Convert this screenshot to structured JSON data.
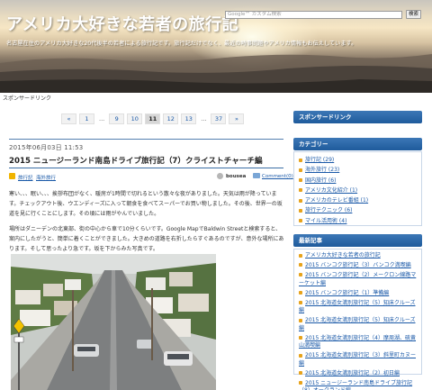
{
  "header": {
    "title": "アメリカ大好きな若者の旅行記",
    "description": "名古屋在住のアメリカ大好きな20代後半の若者による旅行記です。旅行記だけでなく、最近の時事問題やアメリカ情報もお伝えしています。",
    "search_placeholder": "Google™ カスタム検索",
    "search_button": "検索"
  },
  "sponsor_top": "スポンサードリンク",
  "pagination": [
    "«",
    "1",
    "...",
    "9",
    "10",
    "11",
    "12",
    "13",
    "...",
    "37",
    "»"
  ],
  "current_page": "11",
  "post": {
    "date": "2015年06月03日 11:53",
    "title": "2015 ニュージーランド南島ドライブ旅行記（7）クライストチャーチ編",
    "categories": [
      "旅行記",
      "海外旅行"
    ],
    "author": "bousea",
    "comments": "Comment(0)",
    "paragraph1": "寒い、、、眠い、、、挨拶布団がなく、暖房が1時間で切れるという散々な夜がありました。天気は雨が降っています。チェックアウト後、ウエンディーズに入って朝食を食べてスーパーでお買い物しました。その後、世界一の坂道を見に行くことにします。その頃には雨がやんでいました。",
    "paragraph2": "場所はダニーデンの北東部、街の中心から車で10分くらいです。Google MapでBaldwin Streetと検索すると、案内にしたがうと、簡単に着くことができました。大きめの道路を右折したらすぐあるのですが、意外な場所にあります。そして思ったより急です。坂を下からみた写真です。"
  },
  "sidebar": {
    "sponsor_title": "スポンサードリンク",
    "category_title": "カテゴリー",
    "categories": [
      "旅行記 (29)",
      "海外旅行 (23)",
      "国内旅行 (6)",
      "アメリカ文化紹介 (1)",
      "アメリカのテレビ番組 (1)",
      "旅行テクニック (6)",
      "マイル活用術 (4)"
    ],
    "recent_title": "最新記事",
    "recent": [
      "アメリカ大好きな若者の旅行記",
      "2015 バンコク旅行記（3）バンコク満喫編",
      "2015 バンコク旅行記（2）メークロン線路マーケット編",
      "2015 バンコク旅行記（1）準備編",
      "2015 北海道女満別旅行記（5）知床クルーズ編",
      "2015 北海道女満別旅行記（5）知床クルーズ編",
      "2015 北海道女満別旅行記（4）摩周湖、硫黄山満喫編",
      "2015 北海道女満別旅行記（3）斜里町カヌー編",
      "2015 北海道女満別旅行記（2）初日編",
      "2015 ニュージーランド南島ドライブ旅行記（8）オークランド編"
    ]
  }
}
